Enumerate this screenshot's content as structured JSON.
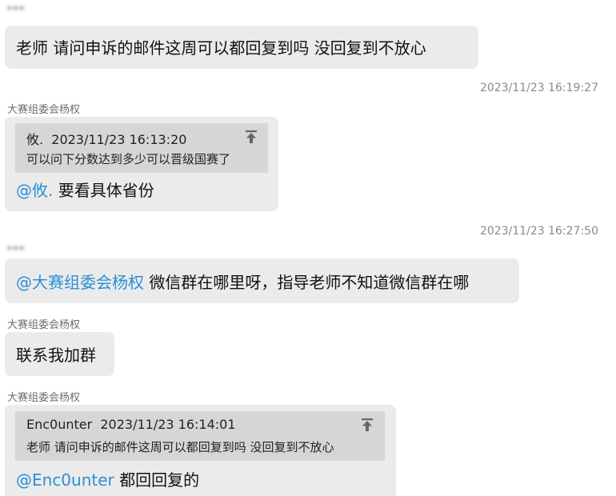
{
  "messages": [
    {
      "sender": "•••",
      "text": "老师 请问申诉的邮件这周可以都回复到吗 没回复到不放心"
    },
    {
      "timestamp": "2023/11/23 16:19:27",
      "sender": "大赛组委会杨权",
      "quote": {
        "author": "攸.",
        "time": "2023/11/23 16:13:20",
        "text": "可以问下分数达到多少可以晋级国赛了"
      },
      "mention": "@攸.",
      "text": "要看具体省份"
    },
    {
      "timestamp": "2023/11/23 16:27:50",
      "sender": "•••",
      "mention": "@大赛组委会杨权",
      "text": "微信群在哪里呀，指导老师不知道微信群在哪"
    },
    {
      "sender": "大赛组委会杨权",
      "text": "联系我加群"
    },
    {
      "sender": "大赛组委会杨权",
      "quote": {
        "author": "Enc0unter",
        "time": "2023/11/23 16:14:01",
        "text": "老师 请问申诉的邮件这周可以都回复到吗 没回复到不放心"
      },
      "mention": "@Enc0unter",
      "text": "都回回复的"
    }
  ],
  "colors": {
    "bubble": "#ebebeb",
    "quote": "#d6d6d6",
    "mention": "#2a8fd6",
    "timestamp": "#8a8a8a"
  },
  "icons": {
    "quote_jump": "arrow-up-to-line-icon"
  }
}
